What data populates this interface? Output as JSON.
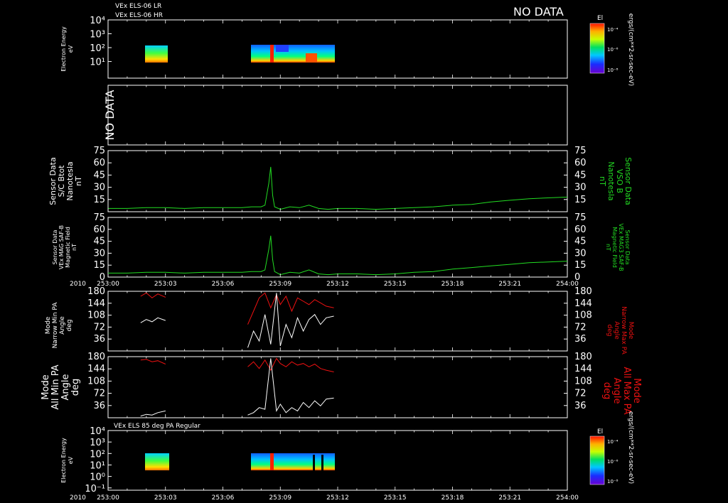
{
  "header": {
    "line1": "VEx ELS-06 LR",
    "line2": "VEx ELS-06 HR",
    "no_data": "NO DATA"
  },
  "colorbar_top": {
    "title": "El",
    "ticks": [
      "10⁻⁴",
      "10⁻⁶",
      "10⁻⁸"
    ],
    "units": "ergs/(cm**2-sr-sec-eV)"
  },
  "colorbar_bottom": {
    "title": "El",
    "ticks": [
      "10⁻⁴",
      "10⁻⁶",
      "10⁻⁸"
    ],
    "units": "ergs/(cm**2-sr-sec-eV)"
  },
  "panel_bottom_title": "VEx ELS 85 deg PA Regular",
  "time_axis": {
    "year": "2010",
    "ticks": [
      "253:00",
      "253:03",
      "253:06",
      "253:09",
      "253:12",
      "253:15",
      "253:18",
      "253:21",
      "254:00"
    ]
  },
  "panels": {
    "spec1": {
      "ylabel": [
        "Electron Energy",
        "eV"
      ],
      "yticks": [
        "10⁴",
        "10³",
        "10²",
        "10¹"
      ]
    },
    "nodata": {
      "ylabel": "NO DATA"
    },
    "mag1": {
      "ylabel": [
        "Sensor Data",
        "S/C Btot",
        "Nanotesla",
        "nT"
      ],
      "rlabel": [
        "Sensor Data",
        "VSO B",
        "Nanotesla",
        "nT"
      ],
      "yticks": [
        "75",
        "60",
        "45",
        "30",
        "15"
      ]
    },
    "mag2": {
      "ylabel": [
        "Sensor Data",
        "VEx MAG SAF-B",
        "Magnetic Field",
        "nT"
      ],
      "rlabel": [
        "Sensor Data",
        "VEx MAG3 SAF-B",
        "Magnetic Field",
        "nT"
      ],
      "yticks": [
        "75",
        "60",
        "45",
        "30",
        "15",
        "0"
      ]
    },
    "pa1": {
      "ylabel": [
        "Mode",
        "Narrow Min PA",
        "Angle",
        "deg"
      ],
      "rlabel": [
        "Mode",
        "Narrow Max PA",
        "Angle",
        "deg"
      ],
      "yticks": [
        "180",
        "144",
        "108",
        "72",
        "36"
      ]
    },
    "pa2": {
      "ylabel": [
        "Mode",
        "All Min PA",
        "Angle",
        "deg"
      ],
      "rlabel": [
        "Mode",
        "All Max PA",
        "Angle",
        "deg"
      ],
      "yticks": [
        "180",
        "144",
        "108",
        "72",
        "36"
      ]
    },
    "spec2": {
      "ylabel": [
        "Electron Energy",
        "eV"
      ],
      "yticks": [
        "10⁴",
        "10³",
        "10²",
        "10¹",
        "10⁰",
        "10⁻¹"
      ]
    }
  },
  "colors": {
    "mag": "#22dd22",
    "pa_max": "#ee1111",
    "pa_min": "#ffffff",
    "axis": "#ffffff"
  },
  "chart_data": [
    {
      "type": "heatmap",
      "panel": "spec1",
      "x_range_hours": [
        0,
        24
      ],
      "y_range_eV_log": [
        0,
        4
      ],
      "data_intervals_hours": [
        [
          1.6,
          3.0
        ],
        [
          7.3,
          11.8
        ]
      ]
    },
    {
      "type": "line",
      "panel": "mag1",
      "ylim": [
        0,
        75
      ],
      "series": [
        {
          "x": [
            0,
            1,
            2,
            3,
            4,
            5,
            6,
            7,
            7.5,
            8,
            8.2,
            8.4,
            8.5,
            8.6,
            8.7,
            9,
            9.5,
            10,
            10.5,
            11,
            11.5,
            12,
            13,
            14,
            15,
            16,
            17,
            18,
            19,
            20,
            21,
            22,
            23,
            24
          ],
          "y": [
            4,
            4,
            5,
            5,
            4,
            5,
            5,
            5,
            6,
            6,
            8,
            35,
            55,
            20,
            6,
            3,
            6,
            5,
            8,
            4,
            3,
            4,
            4,
            3,
            4,
            5,
            6,
            8,
            9,
            12,
            14,
            16,
            17,
            18
          ]
        }
      ]
    },
    {
      "type": "line",
      "panel": "mag2",
      "ylim": [
        0,
        75
      ],
      "series": [
        {
          "x": [
            0,
            1,
            2,
            3,
            4,
            5,
            6,
            7,
            7.5,
            8,
            8.2,
            8.4,
            8.5,
            8.6,
            8.7,
            9,
            9.5,
            10,
            10.5,
            11,
            11.5,
            12,
            13,
            14,
            15,
            16,
            17,
            18,
            19,
            20,
            21,
            22,
            23,
            24
          ],
          "y": [
            5,
            5,
            6,
            6,
            5,
            6,
            6,
            6,
            7,
            7,
            9,
            35,
            52,
            22,
            7,
            3,
            6,
            5,
            9,
            4,
            3,
            4,
            4,
            3,
            4,
            6,
            7,
            10,
            12,
            14,
            16,
            18,
            19,
            20
          ]
        }
      ]
    },
    {
      "type": "line",
      "panel": "pa1",
      "ylim": [
        0,
        180
      ],
      "series": [
        {
          "name": "Mode Narrow Max PA",
          "x": [
            1.7,
            2.0,
            2.3,
            2.6,
            3.0,
            null,
            7.3,
            7.6,
            7.9,
            8.2,
            8.5,
            8.8,
            9.0,
            9.3,
            9.6,
            9.9,
            10.2,
            10.5,
            10.8,
            11.1,
            11.4,
            11.8
          ],
          "y": [
            165,
            175,
            160,
            172,
            162,
            null,
            80,
            120,
            160,
            175,
            130,
            170,
            140,
            165,
            120,
            160,
            150,
            140,
            155,
            145,
            135,
            130
          ]
        },
        {
          "name": "Mode Narrow Min PA",
          "x": [
            1.7,
            2.0,
            2.3,
            2.6,
            3.0,
            null,
            7.3,
            7.6,
            7.9,
            8.2,
            8.5,
            8.8,
            9.0,
            9.3,
            9.6,
            9.9,
            10.2,
            10.5,
            10.8,
            11.1,
            11.4,
            11.8
          ],
          "y": [
            85,
            95,
            88,
            100,
            92,
            null,
            10,
            60,
            30,
            110,
            20,
            175,
            15,
            80,
            40,
            100,
            60,
            95,
            110,
            80,
            100,
            105
          ]
        }
      ]
    },
    {
      "type": "line",
      "panel": "pa2",
      "ylim": [
        0,
        180
      ],
      "series": [
        {
          "name": "Mode All Max PA",
          "x": [
            1.7,
            2.0,
            2.3,
            2.6,
            3.0,
            null,
            7.3,
            7.6,
            7.9,
            8.2,
            8.5,
            8.8,
            9.0,
            9.3,
            9.6,
            9.9,
            10.2,
            10.5,
            10.8,
            11.1,
            11.4,
            11.8
          ],
          "y": [
            170,
            172,
            165,
            168,
            158,
            null,
            150,
            165,
            145,
            170,
            140,
            175,
            160,
            150,
            165,
            155,
            160,
            150,
            158,
            145,
            140,
            135
          ]
        },
        {
          "name": "Mode All Min PA",
          "x": [
            1.7,
            2.0,
            2.3,
            2.6,
            3.0,
            null,
            7.3,
            7.6,
            7.9,
            8.2,
            8.5,
            8.8,
            9.0,
            9.3,
            9.6,
            9.9,
            10.2,
            10.5,
            10.8,
            11.1,
            11.4,
            11.8
          ],
          "y": [
            5,
            10,
            8,
            15,
            20,
            null,
            8,
            15,
            30,
            25,
            175,
            20,
            40,
            15,
            30,
            20,
            45,
            30,
            50,
            35,
            55,
            58
          ]
        }
      ]
    },
    {
      "type": "heatmap",
      "panel": "spec2",
      "x_range_hours": [
        0,
        24
      ],
      "y_range_eV_log": [
        -1,
        4
      ],
      "data_intervals_hours": [
        [
          1.6,
          3.0
        ],
        [
          7.3,
          11.8
        ]
      ]
    }
  ]
}
